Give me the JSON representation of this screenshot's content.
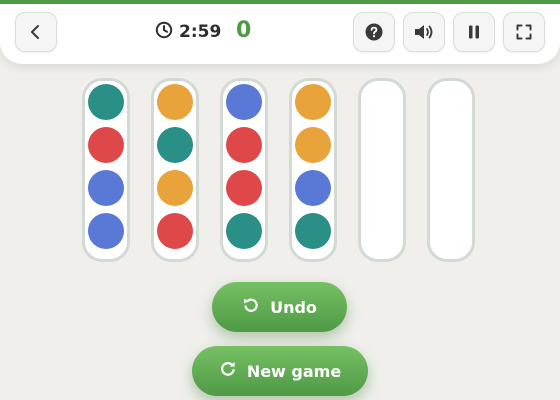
{
  "header": {
    "timer": "2:59",
    "score": "0",
    "buttons": {
      "back": "chevron-left-icon",
      "help": "help-icon",
      "sound": "speaker-icon",
      "pause": "pause-icon",
      "fullscreen": "fullscreen-icon"
    }
  },
  "board": {
    "tubes": [
      [
        "#2a8f86",
        "#df4848",
        "#5a78d5",
        "#5a78d5"
      ],
      [
        "#e8a33a",
        "#2a8f86",
        "#e8a33a",
        "#df4848"
      ],
      [
        "#5a78d5",
        "#df4848",
        "#df4848",
        "#2a8f86"
      ],
      [
        "#e8a33a",
        "#e8a33a",
        "#5a78d5",
        "#2a8f86"
      ],
      [],
      []
    ]
  },
  "actions": {
    "undo_label": "Undo",
    "new_game_label": "New game"
  },
  "colors": {
    "accent": "#4e9a45",
    "teal": "#2a8f86",
    "red": "#df4848",
    "blue": "#5a78d5",
    "orange": "#e8a33a"
  }
}
